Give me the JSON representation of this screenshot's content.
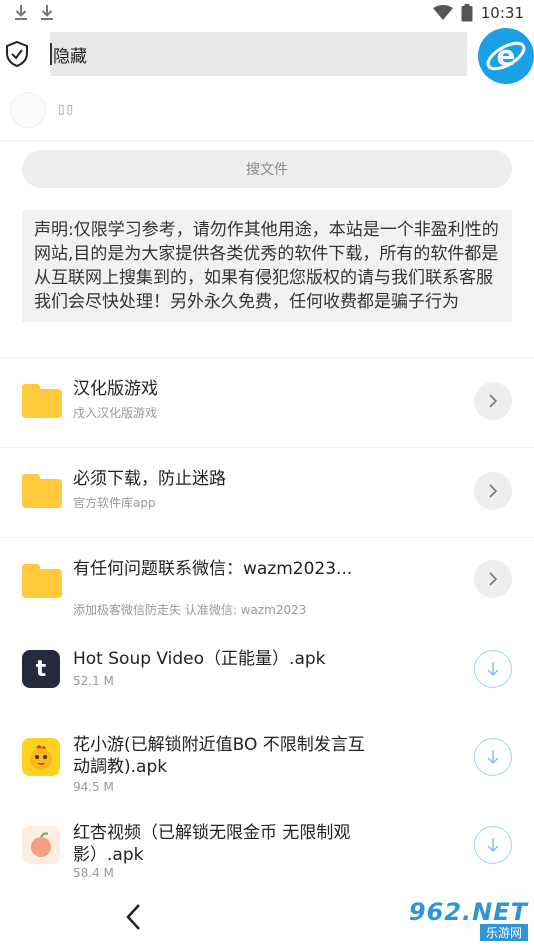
{
  "status_bar": {
    "time": "10:31"
  },
  "top_bar": {
    "search_text": "隐藏"
  },
  "user": {
    "name": "▯▯"
  },
  "file_search": {
    "placeholder": "搜文件"
  },
  "notice": {
    "text": "声明:仅限学习参考，请勿作其他用途，本站是一个非盈利性的网站,目的是为大家提供各类优秀的软件下载，所有的软件都是从互联网上搜集到的，如果有侵犯您版权的请与我们联系客服 我们会尽快处理！另外永久免费，任何收费都是骗子行为"
  },
  "folders": [
    {
      "title": "汉化版游戏",
      "subtitle": "戍入汉化版游戏"
    },
    {
      "title": "必须下载，防止迷路",
      "subtitle": "官方软件库app"
    },
    {
      "title": "有任何问题联系微信：wazm2023...",
      "subtitle": "添加极客微信防走失 认准微信: wazm2023"
    }
  ],
  "apps": [
    {
      "title": "Hot Soup Video（正能量）.apk",
      "size": "52.1 M",
      "icon": "hot-soup-t-icon",
      "color": "#262a3a"
    },
    {
      "title": "花小游(已解锁附近值BO 不限制发言互动調教).apk",
      "size": "94.5 M",
      "icon": "chick-icon",
      "color": "#ffd21e"
    },
    {
      "title": "红杏视频（已解锁无限金币 无限制观影）.apk",
      "size": "58.4 M",
      "icon": "apricot-icon",
      "color": "#fdeee4"
    }
  ],
  "watermark": {
    "top": "962.NET",
    "bottom": "乐游网"
  },
  "colors": {
    "accent": "#1aa0e6",
    "folder": "#ffcb3d",
    "download_ring": "#9fd3ef"
  }
}
